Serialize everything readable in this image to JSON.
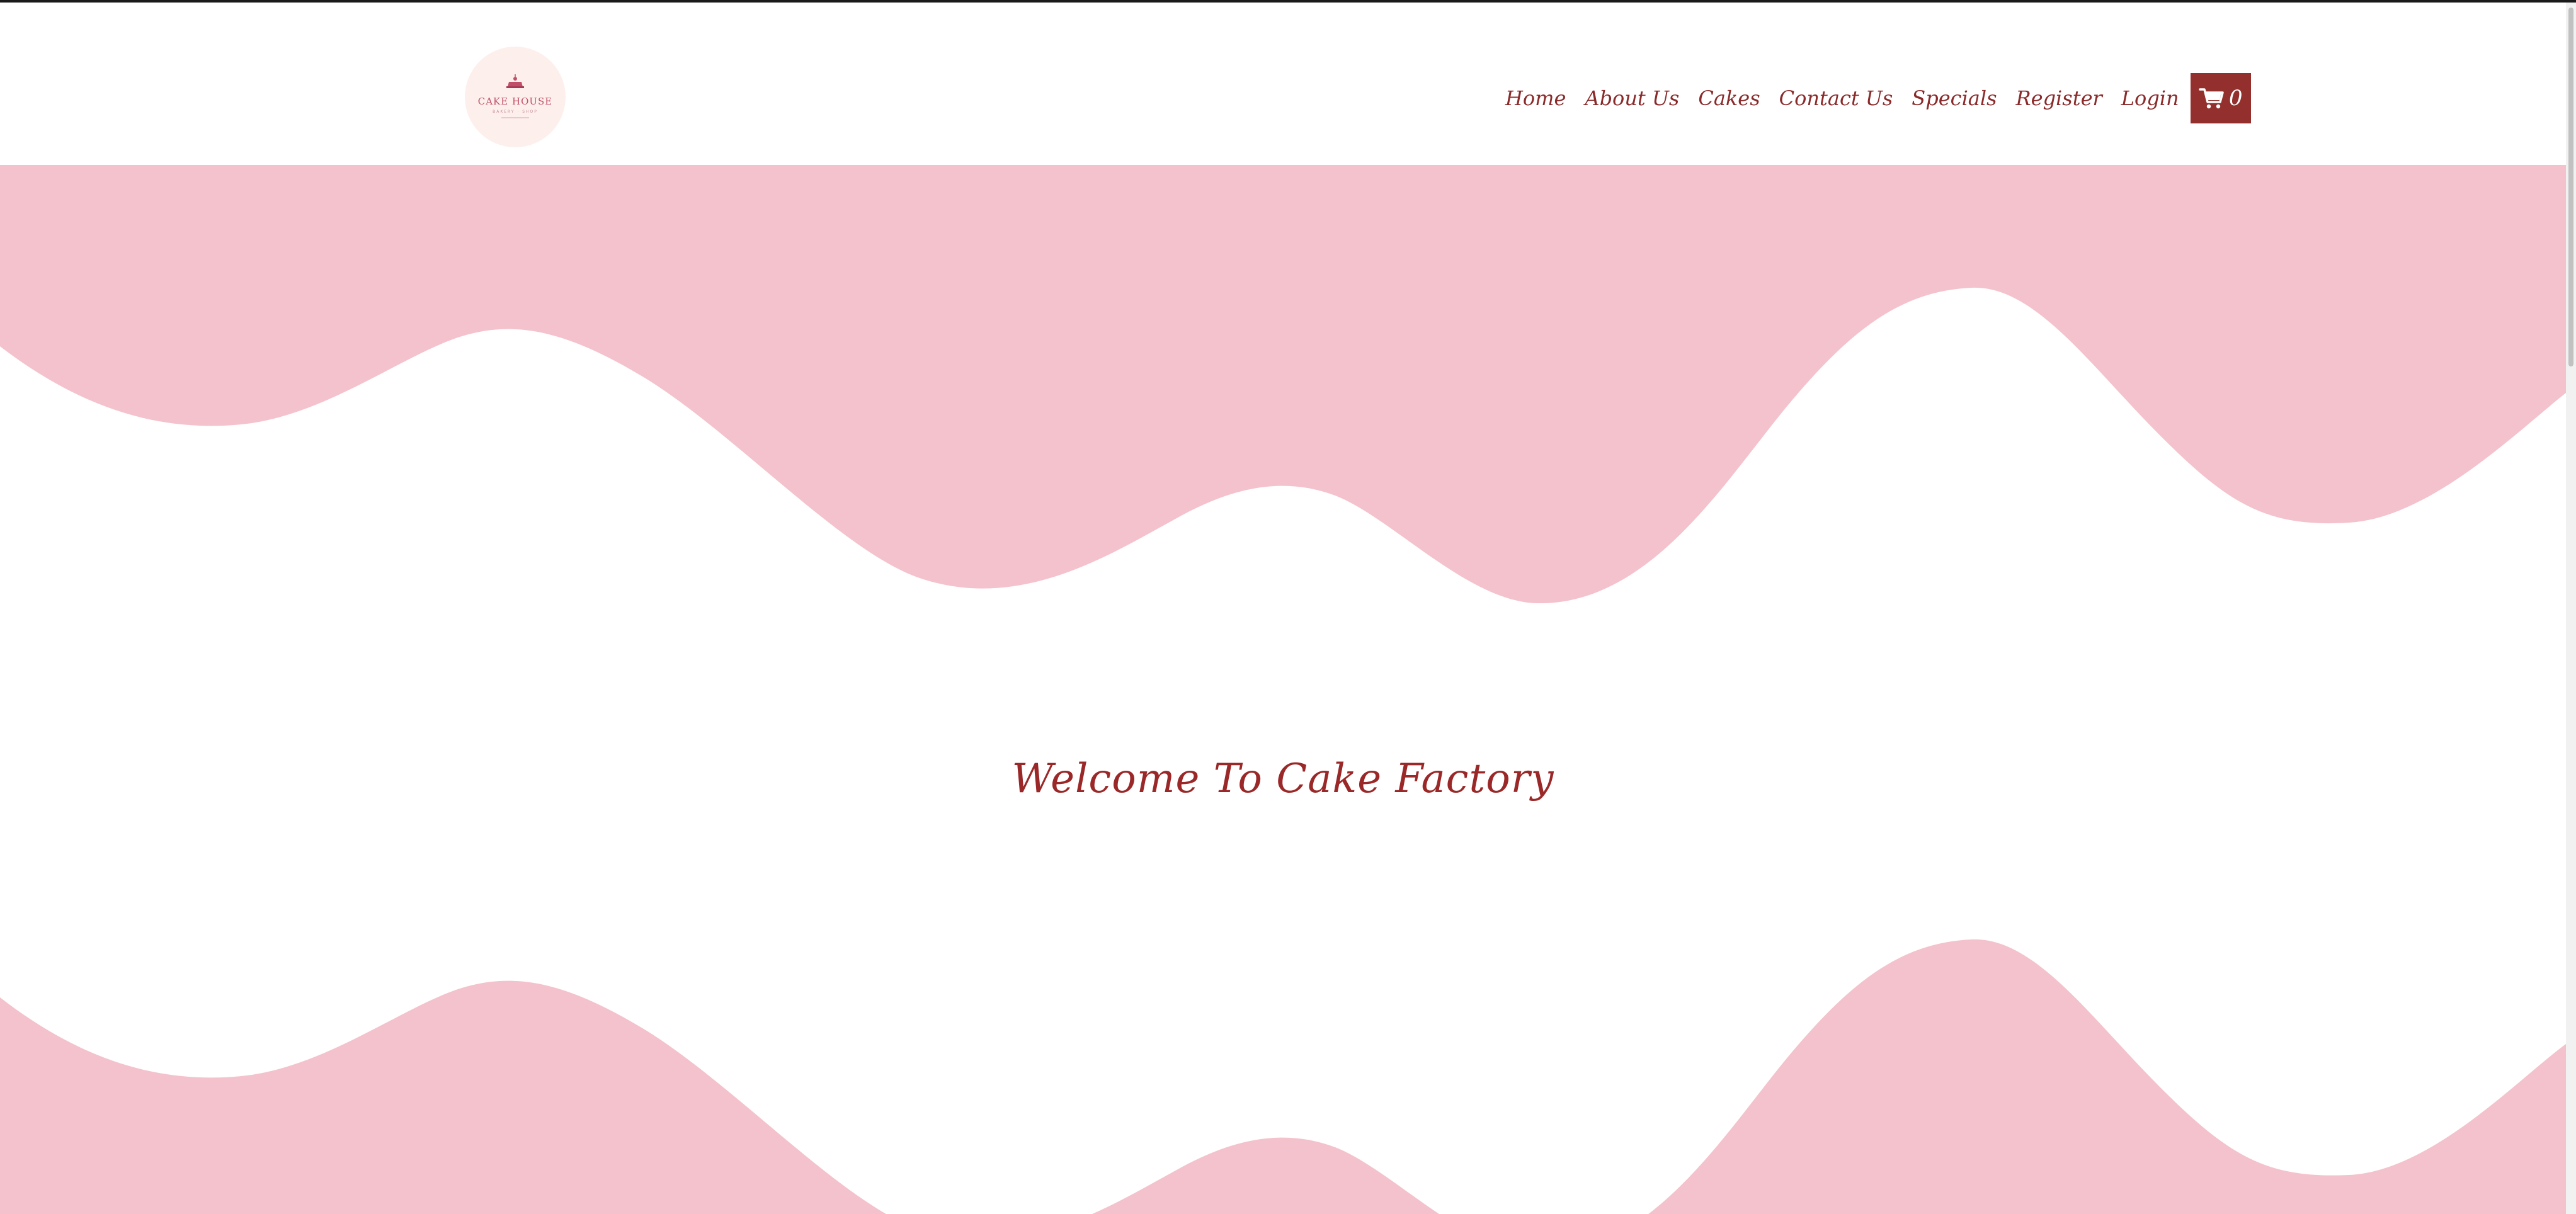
{
  "brand": {
    "logo_text": "CAKE HOUSE",
    "logo_subtext": "BAKERY · SHOP"
  },
  "nav": {
    "items": [
      "Home",
      "About Us",
      "Cakes",
      "Contact Us",
      "Specials",
      "Register",
      "Login"
    ],
    "cart_icon": "shopping-cart-icon",
    "cart_count": "0"
  },
  "hero": {
    "welcome_text": "Welcome To Cake Factory"
  },
  "colors": {
    "accent": "#93302e",
    "nav_text": "#8a2a2a",
    "wave_pink": "#f4c2cc",
    "logo_bg": "#fdf0ec"
  }
}
